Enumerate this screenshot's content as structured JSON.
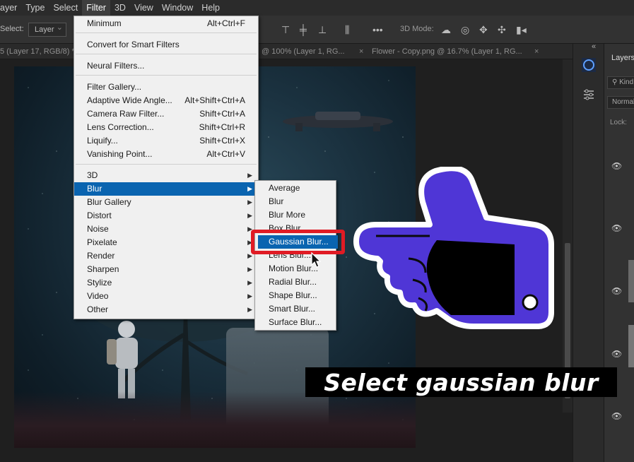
{
  "menubar": {
    "items": [
      "ayer",
      "Type",
      "Select",
      "Filter",
      "3D",
      "View",
      "Window",
      "Help"
    ],
    "active_index": 3
  },
  "options_bar": {
    "select_label": "Select:",
    "select_value": "Layer",
    "mode_label": "3D Mode:"
  },
  "doc_tabs": {
    "tab1": "5 (Layer 17, RGB/8) *",
    "tab2": "@ 100% (Layer 1, RG...",
    "tab3": "Flower - Copy.png @ 16.7% (Layer 1, RG...",
    "close": "×"
  },
  "layers_panel": {
    "title": "Layers",
    "search_placeholder": "Kind",
    "blend_mode": "Normal",
    "lock_label": "Lock:"
  },
  "filter_menu": {
    "items": [
      {
        "label": "Minimum",
        "shortcut": "Alt+Ctrl+F"
      },
      {
        "label": "Convert for Smart Filters"
      },
      {
        "label": "Neural Filters..."
      },
      {
        "label": "Filter Gallery..."
      },
      {
        "label": "Adaptive Wide Angle...",
        "shortcut": "Alt+Shift+Ctrl+A"
      },
      {
        "label": "Camera Raw Filter...",
        "shortcut": "Shift+Ctrl+A"
      },
      {
        "label": "Lens Correction...",
        "shortcut": "Shift+Ctrl+R"
      },
      {
        "label": "Liquify...",
        "shortcut": "Shift+Ctrl+X"
      },
      {
        "label": "Vanishing Point...",
        "shortcut": "Alt+Ctrl+V"
      },
      {
        "label": "3D"
      },
      {
        "label": "Blur"
      },
      {
        "label": "Blur Gallery"
      },
      {
        "label": "Distort"
      },
      {
        "label": "Noise"
      },
      {
        "label": "Pixelate"
      },
      {
        "label": "Render"
      },
      {
        "label": "Sharpen"
      },
      {
        "label": "Stylize"
      },
      {
        "label": "Video"
      },
      {
        "label": "Other"
      }
    ],
    "submenu_arrow": "▶"
  },
  "blur_menu": {
    "items": [
      "Average",
      "Blur",
      "Blur More",
      "Box Blur...",
      "Gaussian Blur...",
      "Lens Blur...",
      "Motion Blur...",
      "Radial Blur...",
      "Shape Blur...",
      "Smart Blur...",
      "Surface Blur..."
    ],
    "highlighted_index": 4
  },
  "caption": "Select gaussian blur",
  "colors": {
    "menu_highlight": "#0a64b0",
    "red_outline": "#e01b24",
    "hand_fill": "#4f36d6"
  }
}
